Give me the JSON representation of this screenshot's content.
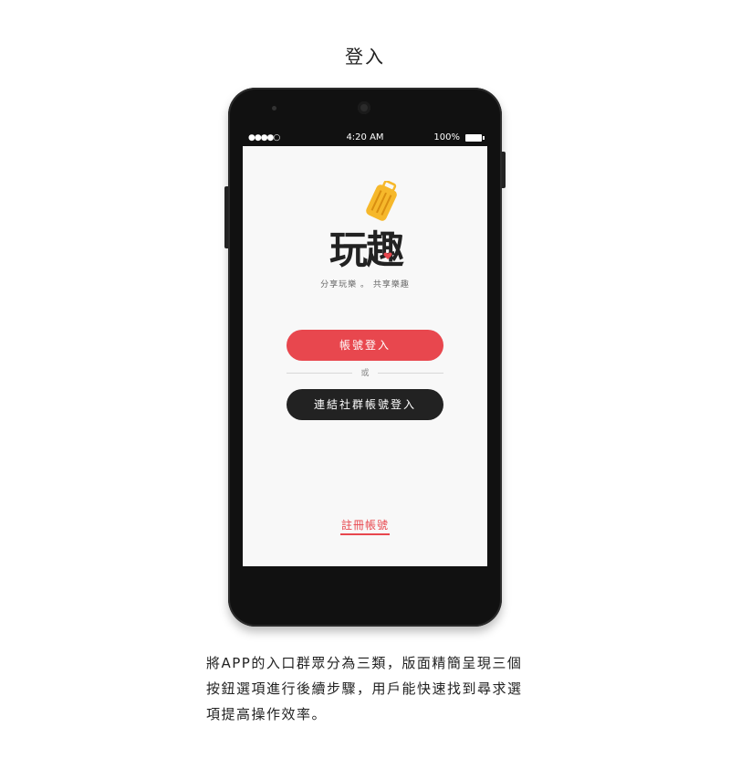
{
  "page": {
    "title": "登入"
  },
  "statusbar": {
    "signal": "●●●●○",
    "time": "4:20 AM",
    "battery": "100%"
  },
  "logo": {
    "text": "玩趣"
  },
  "tagline": "分享玩樂 。 共享樂趣",
  "buttons": {
    "account_login": "帳號登入",
    "divider": "或",
    "social_login": "連結社群帳號登入",
    "register": "註冊帳號"
  },
  "description": {
    "lines": [
      "將APP的入口群眾分為三類，版面精簡呈現三個",
      "按鈕選項進行後續步驟，用戶能快速找到尋求選",
      "項提高操作效率。"
    ]
  },
  "colors": {
    "accent_red": "#e8474e",
    "dark": "#222222",
    "logo_yellow": "#f6b82b"
  }
}
